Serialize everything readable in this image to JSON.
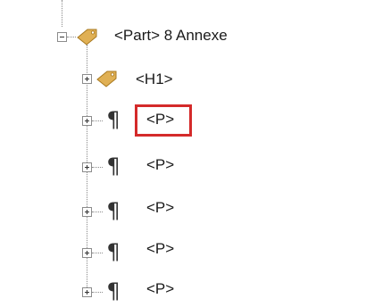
{
  "tree": {
    "root": {
      "label": "<Part> 8 Annexe",
      "expander": "minus",
      "icon": "tag-icon"
    },
    "children": [
      {
        "label": "<H1>",
        "expander": "plus",
        "icon": "tag-icon"
      },
      {
        "label": "<P>",
        "expander": "plus",
        "icon": "paragraph-icon",
        "highlighted": true
      },
      {
        "label": "<P>",
        "expander": "plus",
        "icon": "paragraph-icon"
      },
      {
        "label": "<P>",
        "expander": "plus",
        "icon": "paragraph-icon"
      },
      {
        "label": "<P>",
        "expander": "plus",
        "icon": "paragraph-icon"
      },
      {
        "label": "<P>",
        "expander": "plus",
        "icon": "paragraph-icon"
      }
    ]
  },
  "colors": {
    "highlight_border": "#d42a2a",
    "tag_fill": "#e0b054",
    "tag_edge": "#a8791f",
    "connector": "#8a8a8a"
  }
}
